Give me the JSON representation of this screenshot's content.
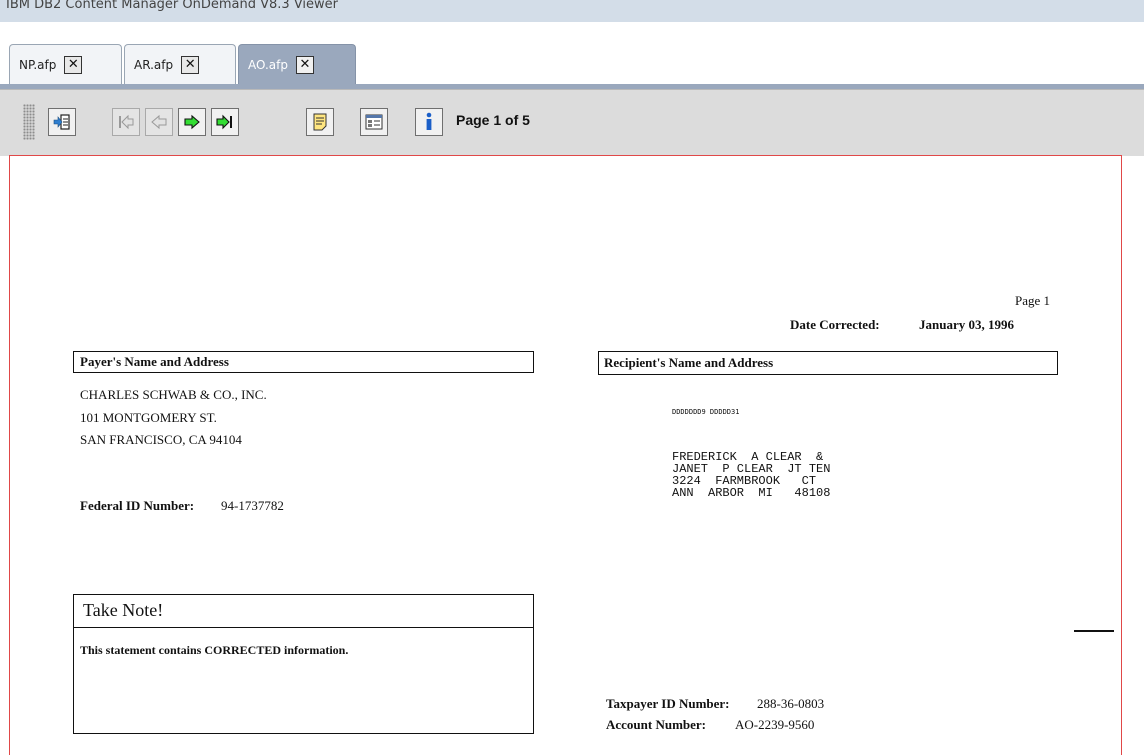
{
  "window": {
    "title": "IBM DB2 Content Manager OnDemand V8.3 Viewer"
  },
  "tabs": [
    {
      "label": "NP.afp",
      "active": false
    },
    {
      "label": "AR.afp",
      "active": false
    },
    {
      "label": "AO.afp",
      "active": true
    }
  ],
  "toolbar": {
    "page_indicator": "Page 1 of 5",
    "buttons": [
      {
        "name": "go-to-page-icon",
        "enabled": true
      },
      {
        "name": "first-page-icon",
        "enabled": false
      },
      {
        "name": "previous-page-icon",
        "enabled": false
      },
      {
        "name": "next-page-icon",
        "enabled": true
      },
      {
        "name": "last-page-icon",
        "enabled": true
      },
      {
        "name": "notes-icon",
        "enabled": true
      },
      {
        "name": "properties-icon",
        "enabled": true
      },
      {
        "name": "info-icon",
        "enabled": true
      }
    ]
  },
  "document": {
    "page_label": "Page 1",
    "date_corrected_label": "Date Corrected:",
    "date_corrected_value": "January 03, 1996",
    "payer_header": "Payer's Name and Address",
    "payer_lines": [
      "CHARLES  SCHWAB  & CO., INC.",
      "101 MONTGOMERY   ST.",
      "SAN FRANCISCO,   CA    94104"
    ],
    "federal_id_label": "Federal ID Number:",
    "federal_id_value": "94-1737782",
    "recipient_header": "Recipient's   Name  and  Address",
    "barcode_text": "DDDDDDD9 DDDDD31",
    "recipient_lines": [
      "FREDERICK  A CLEAR  &",
      "JANET  P CLEAR  JT TEN",
      "3224  FARMBROOK   CT",
      "ANN  ARBOR  MI   48108"
    ],
    "take_note_header": "Take  Note!",
    "take_note_text": "This statement contains CORRECTED    information.",
    "taxpayer_id_label": "Taxpayer  ID Number:",
    "taxpayer_id_value": "288-36-0803",
    "account_number_label": "Account  Number:",
    "account_number_value": "AO-2239-9560"
  },
  "colors": {
    "titlebar": "#d3dde8",
    "active_tab": "#9aa8bd",
    "toolbar": "#dcdcdc",
    "page_border": "#e04848"
  }
}
